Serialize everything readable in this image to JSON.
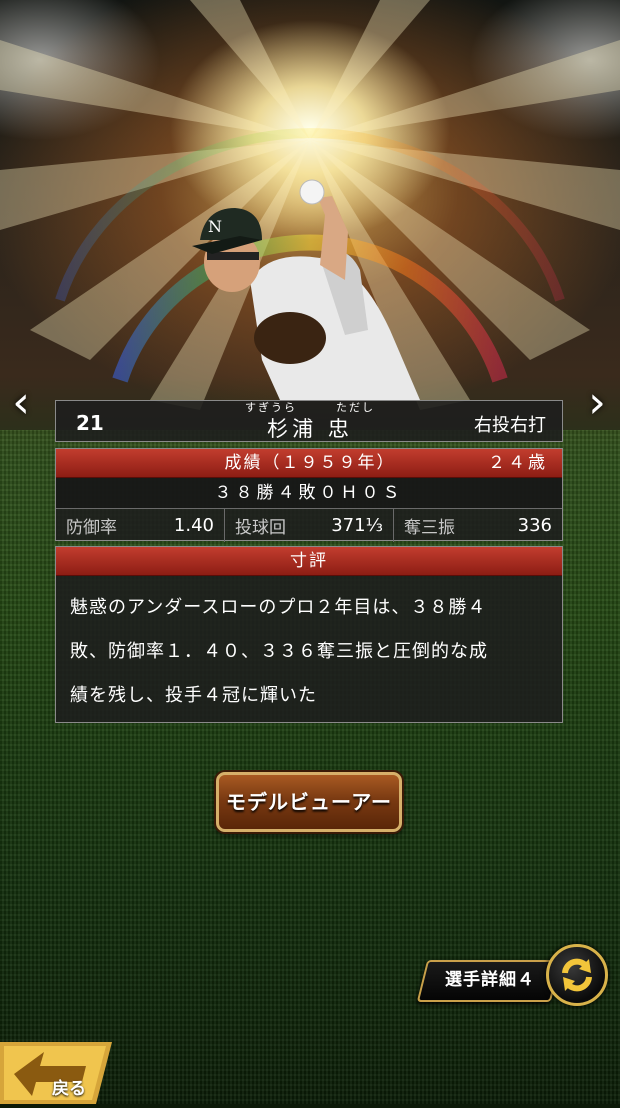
{
  "player": {
    "number": "21",
    "furigana_surname": "すぎうら",
    "furigana_given": "ただし",
    "name": "杉浦 忠",
    "handedness": "右投右打"
  },
  "stats": {
    "season_label": "成績（１９５９年）",
    "age": "２４歳",
    "record": "３８勝４敗０Ｈ０Ｓ",
    "cells": [
      {
        "label": "防御率",
        "value": "1.40"
      },
      {
        "label": "投球回",
        "value": "371⅓"
      },
      {
        "label": "奪三振",
        "value": "336"
      }
    ]
  },
  "review": {
    "title": "寸評",
    "lines": [
      "魅惑のアンダースローのプロ２年目は、３８勝４",
      "敗、防御率１．４０、３３６奪三振と圧倒的な成",
      "績を残し、投手４冠に輝いた"
    ]
  },
  "buttons": {
    "model_viewer": "モデルビューアー",
    "player_detail": "選手詳細４",
    "back": "戻る"
  },
  "icons": {
    "prev": "chevron-left-icon",
    "next": "chevron-right-icon",
    "cycle": "cycle-arrows-icon",
    "back": "back-arrow-icon"
  }
}
